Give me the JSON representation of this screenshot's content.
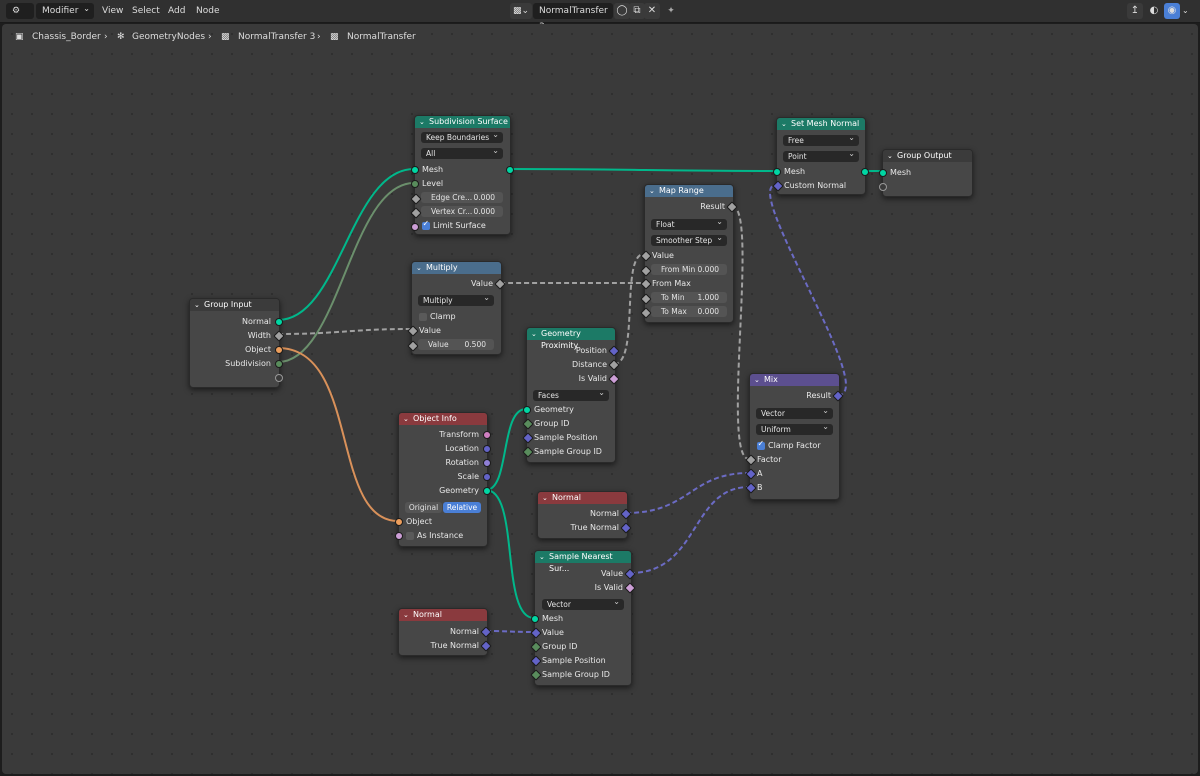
{
  "header": {
    "editor_type_icon": "node-editor-icon",
    "mode": "Modifier",
    "menus": [
      "View",
      "Select",
      "Add",
      "Node"
    ],
    "tree_name": "NormalTransfer 3",
    "icons": [
      "fake-user-shield-icon",
      "duplicate-icon",
      "close-icon",
      "pin-icon",
      "parent-up-icon",
      "overlay-icon",
      "snap-icon"
    ]
  },
  "breadcrumb": [
    "Chassis_Border",
    "GeometryNodes",
    "NormalTransfer 3",
    "NormalTransfer"
  ],
  "colors": {
    "geometry": "#00d6a3",
    "float": "#a1a1a1",
    "vector": "#6363c7",
    "object": "#ed9e5c",
    "matrix": "#cf7fc1",
    "integer": "#598c5c",
    "header_geometry": "#1c7a66",
    "header_converter": "#4a6d8c",
    "header_input": "#8a3a3e",
    "header_mix": "#5c4f8f"
  },
  "nodes": {
    "group_input": {
      "title": "Group Input",
      "outputs": [
        "Normal",
        "Width",
        "Object",
        "Subdivision"
      ]
    },
    "subdivision": {
      "title": "Subdivision Surface",
      "uv_smooth": "Keep Boundaries",
      "boundary": "All",
      "inputs": [
        "Mesh",
        "Level"
      ],
      "edge_crease": {
        "label": "Edge Cre...",
        "value": "0.000"
      },
      "vertex_crease": {
        "label": "Vertex Cr...",
        "value": "0.000"
      },
      "limit_surface": "Limit Surface"
    },
    "multiply": {
      "title": "Multiply",
      "output": "Value",
      "operation": "Multiply",
      "clamp": "Clamp",
      "input": "Value",
      "value_field": {
        "label": "Value",
        "value": "0.500"
      }
    },
    "map_range": {
      "title": "Map Range",
      "output": "Result",
      "data_type": "Float",
      "interpolation": "Smoother Step",
      "value": "Value",
      "from_min": {
        "label": "From Min",
        "value": "0.000"
      },
      "from_max": "From Max",
      "to_min": {
        "label": "To Min",
        "value": "1.000"
      },
      "to_max": {
        "label": "To Max",
        "value": "0.000"
      }
    },
    "set_mesh_normal": {
      "title": "Set Mesh Normal",
      "mode": "Free",
      "domain": "Point",
      "inputs": [
        "Mesh",
        "Custom Normal"
      ]
    },
    "group_output": {
      "title": "Group Output",
      "input": "Mesh"
    },
    "geometry_proximity": {
      "title": "Geometry Proximity",
      "outputs": [
        "Position",
        "Distance",
        "Is Valid"
      ],
      "target": "Faces",
      "inputs": [
        "Geometry",
        "Group ID",
        "Sample Position",
        "Sample Group ID"
      ]
    },
    "object_info": {
      "title": "Object Info",
      "outputs": [
        "Transform",
        "Location",
        "Rotation",
        "Scale",
        "Geometry"
      ],
      "modes": [
        "Original",
        "Relative"
      ],
      "inputs": [
        "Object"
      ],
      "as_instance": "As Instance"
    },
    "mix": {
      "title": "Mix",
      "output": "Result",
      "data_type": "Vector",
      "factor_mode": "Uniform",
      "clamp": "Clamp Factor",
      "inputs": [
        "Factor",
        "A",
        "B"
      ]
    },
    "normal_1": {
      "title": "Normal",
      "outputs": [
        "Normal",
        "True Normal"
      ]
    },
    "sample_nearest": {
      "title": "Sample Nearest Sur...",
      "outputs": [
        "Value",
        "Is Valid"
      ],
      "data_type": "Vector",
      "inputs": [
        "Mesh",
        "Value",
        "Group ID",
        "Sample Position",
        "Sample Group ID"
      ]
    },
    "normal_2": {
      "title": "Normal",
      "outputs": [
        "Normal",
        "True Normal"
      ]
    }
  }
}
